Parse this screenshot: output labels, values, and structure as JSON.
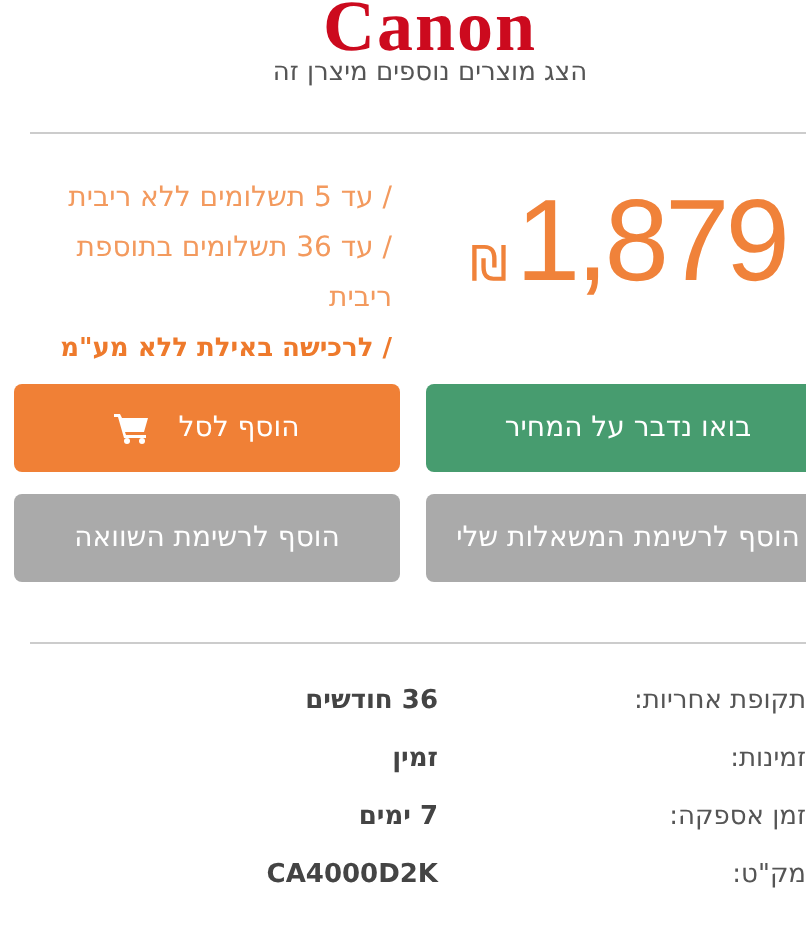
{
  "brand": {
    "logo": "Canon",
    "more_link": "הצג מוצרים נוספים מיצרן זה"
  },
  "price": {
    "amount": "1,879",
    "currency": "₪"
  },
  "payment_terms": [
    {
      "text": "/ עד 5 תשלומים ללא ריבית",
      "emphasis": false
    },
    {
      "text": "/ עד 36 תשלומים בתוספת ריבית",
      "emphasis": false
    },
    {
      "text": "/ לרכישה באילת ללא מע\"מ",
      "emphasis": true
    }
  ],
  "buttons": [
    {
      "label": "בואו נדבר על המחיר",
      "kind": "contact"
    },
    {
      "label": "הוסף לסל",
      "kind": "cart"
    },
    {
      "label": "הוסף לרשימת המשאלות שלי",
      "kind": "list"
    },
    {
      "label": "הוסף לרשימת השוואה",
      "kind": "list"
    }
  ],
  "details": [
    {
      "label": "תקופת אחריות:",
      "value": "36 חודשים"
    },
    {
      "label": "זמינות:",
      "value": "זמין"
    },
    {
      "label": "זמן אספקה:",
      "value": "7 ימים"
    },
    {
      "label": "מק\"ט:",
      "value": "CA4000D2K"
    }
  ]
}
